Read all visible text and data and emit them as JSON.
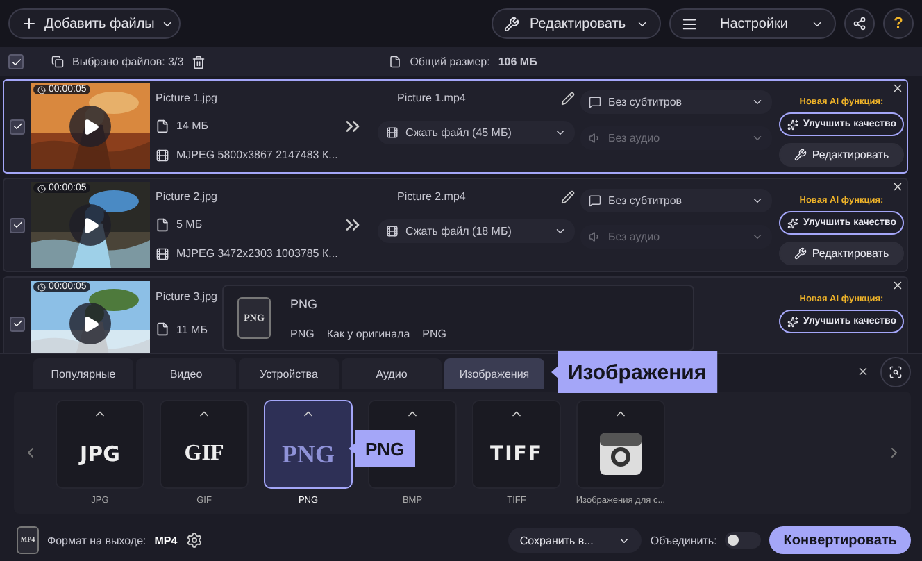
{
  "toolbar": {
    "add_files": "Добавить файлы",
    "edit": "Редактировать",
    "settings": "Настройки",
    "help": "?"
  },
  "selection_bar": {
    "checked": true,
    "selected_count": "Выбрано файлов: 3/3",
    "total_label": "Общий размер:",
    "total_value": "106 МБ"
  },
  "files": [
    {
      "checked": true,
      "selected": true,
      "duration": "00:00:05",
      "source_name": "Picture 1.jpg",
      "source_size": "14 МБ",
      "codec_info": "MJPEG 5800x3867 2147483 К...",
      "output_name": "Picture 1.mp4",
      "compression": "Сжать файл (45 МБ)",
      "subtitles": "Без субтитров",
      "audio": "Без аудио",
      "ai_label": "Новая AI функция:",
      "enhance": "Улучшить качество",
      "edit": "Редактировать"
    },
    {
      "checked": true,
      "selected": false,
      "duration": "00:00:05",
      "source_name": "Picture 2.jpg",
      "source_size": "5 МБ",
      "codec_info": "MJPEG 3472x2303 1003785 К...",
      "output_name": "Picture 2.mp4",
      "compression": "Сжать файл (18 МБ)",
      "subtitles": "Без субтитров",
      "audio": "Без аудио",
      "ai_label": "Новая AI функция:",
      "enhance": "Улучшить качество",
      "edit": "Редактировать"
    },
    {
      "checked": true,
      "selected": false,
      "duration": "00:00:05",
      "source_name": "Picture 3.jpg",
      "source_size": "11 МБ",
      "ai_label": "Новая AI функция:",
      "enhance": "Улучшить качество"
    }
  ],
  "format_popup": {
    "icon_label": "PNG",
    "title": "PNG",
    "details": [
      "PNG",
      "Как у оригинала",
      "PNG"
    ]
  },
  "format_tabs": [
    {
      "label": "Популярные",
      "selected": false
    },
    {
      "label": "Видео",
      "selected": false
    },
    {
      "label": "Устройства",
      "selected": false
    },
    {
      "label": "Аудио",
      "selected": false
    },
    {
      "label": "Изображения",
      "selected": true
    }
  ],
  "tab_tooltip": "Изображения",
  "formats": [
    {
      "kind": "logo",
      "logo": "JPG",
      "label": "JPG",
      "selected": false
    },
    {
      "kind": "logo",
      "logo": "GIF",
      "label": "GIF",
      "selected": false
    },
    {
      "kind": "logo",
      "logo": "PNG",
      "label": "PNG",
      "selected": true
    },
    {
      "kind": "blank",
      "label": "BMP",
      "selected": false
    },
    {
      "kind": "logo",
      "logo": "TIFF",
      "label": "TIFF",
      "selected": false
    },
    {
      "kind": "camera",
      "label": "Изображения для с...",
      "selected": false
    }
  ],
  "format_tooltip": "PNG",
  "bottom_bar": {
    "format_icon_label": "MP4",
    "output_label": "Формат на выходе:",
    "output_value": "MP4",
    "save": "Сохранить в...",
    "merge_label": "Объединить:",
    "merge_on": false,
    "convert": "Конвертировать"
  }
}
